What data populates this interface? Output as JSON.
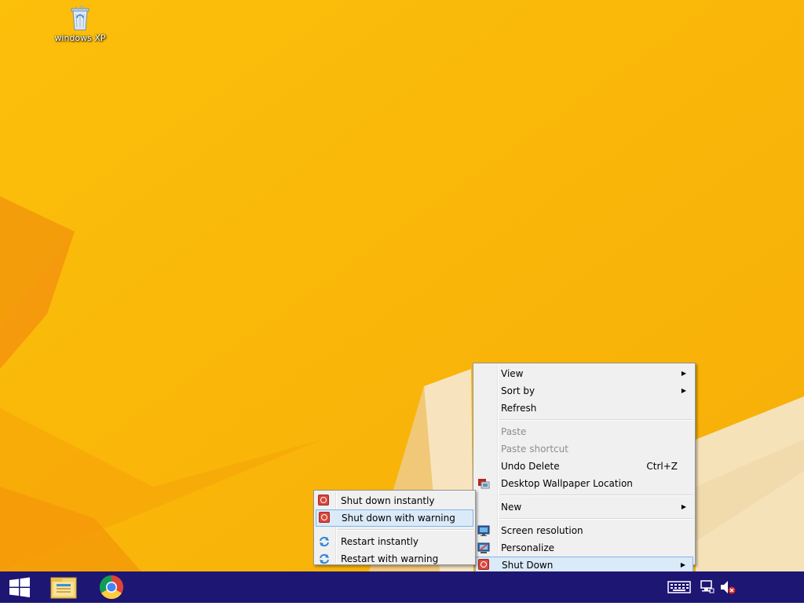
{
  "desktop": {
    "background_color": "#fbb909",
    "icons": [
      {
        "label": "windows XP",
        "icon": "recycle-bin-icon"
      }
    ]
  },
  "context_menu": {
    "items": [
      {
        "label": "View",
        "has_submenu": true
      },
      {
        "label": "Sort by",
        "has_submenu": true
      },
      {
        "label": "Refresh"
      },
      {
        "label": "Paste",
        "disabled": true
      },
      {
        "label": "Paste shortcut",
        "disabled": true
      },
      {
        "label": "Undo Delete",
        "shortcut": "Ctrl+Z"
      },
      {
        "label": "Desktop Wallpaper Location",
        "icon": "wallpaper-icon"
      },
      {
        "label": "New",
        "has_submenu": true
      },
      {
        "label": "Screen resolution",
        "icon": "monitor-icon"
      },
      {
        "label": "Personalize",
        "icon": "personalize-icon"
      },
      {
        "label": "Shut Down",
        "has_submenu": true,
        "icon": "power-icon",
        "highlighted": true
      }
    ]
  },
  "shutdown_submenu": {
    "items": [
      {
        "label": "Shut down instantly",
        "icon": "power-icon"
      },
      {
        "label": "Shut down with warning",
        "icon": "power-icon",
        "highlighted": true
      },
      {
        "label": "Restart instantly",
        "icon": "restart-icon"
      },
      {
        "label": "Restart with warning",
        "icon": "restart-icon"
      }
    ]
  },
  "taskbar": {
    "background_color": "#1e1673",
    "pinned": [
      {
        "name": "start-button",
        "icon": "windows-logo-icon"
      },
      {
        "name": "file-explorer",
        "icon": "folder-icon"
      },
      {
        "name": "chrome",
        "icon": "chrome-icon"
      }
    ],
    "tray": [
      {
        "icon": "keyboard-icon"
      },
      {
        "icon": "network-icon"
      },
      {
        "icon": "volume-muted-icon"
      }
    ]
  }
}
